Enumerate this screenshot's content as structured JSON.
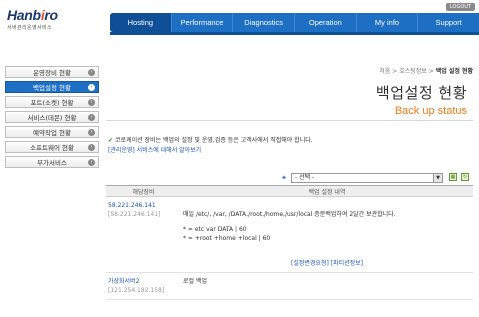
{
  "header": {
    "logo": {
      "main_left": "Hanb",
      "main_dot": "i",
      "main_right": "ro",
      "subtitle": "서버관리운영서비스"
    },
    "logout_label": "LOGOUT",
    "nav": [
      "Hosting",
      "Performance",
      "Diagnostics",
      "Operation",
      "My info",
      "Support"
    ],
    "active_nav": "Hosting"
  },
  "sidebar": {
    "items": [
      {
        "label": "운영장비 현황",
        "active": false
      },
      {
        "label": "백업설정 현황",
        "active": true
      },
      {
        "label": "포트(소켓) 현황",
        "active": false
      },
      {
        "label": "서비스(데몬) 현황",
        "active": false
      },
      {
        "label": "예약작업 현황",
        "active": false
      },
      {
        "label": "소프트웨어 현황",
        "active": false
      },
      {
        "label": "부가서비스",
        "active": false
      }
    ],
    "arrow_glyph": "›"
  },
  "content": {
    "breadcrumb": {
      "home": "처음",
      "sep1": ">",
      "section": "호스팅정보",
      "sep2": ">",
      "current": "백업 설정 현황"
    },
    "title_ko": "백업설정 현황",
    "title_en": "Back up status",
    "notice": "코로케이션 장비는 백업의 설정 및 운영,검증 등은 고객사에서 직접해야 합니다.",
    "notice_link": "[관리운영] 서비스에 대해서 알아보기",
    "select": {
      "value": "- 선택 -"
    },
    "table": {
      "headers": [
        "해당장비",
        "백업 설정 내역"
      ],
      "rows": [
        {
          "host_name": "58.221.246.141",
          "host_ip": "[58.221.246.141]",
          "detail_lines": [
            "매일 /etc/, /var, /DATA,/root,/home,/usr/local 증분백업하여 2달간 보관합니다.",
            "",
            "* = etc var DATA | 60",
            "* = +root +home +local | 60"
          ],
          "detail_links": "[설정변경요청] [파티션정보]"
        },
        {
          "host_name": "가상화서버2",
          "host_ip": "[121.254.182.158]",
          "detail_lines": [
            "로컬 백업"
          ],
          "detail_links": ""
        }
      ]
    }
  }
}
